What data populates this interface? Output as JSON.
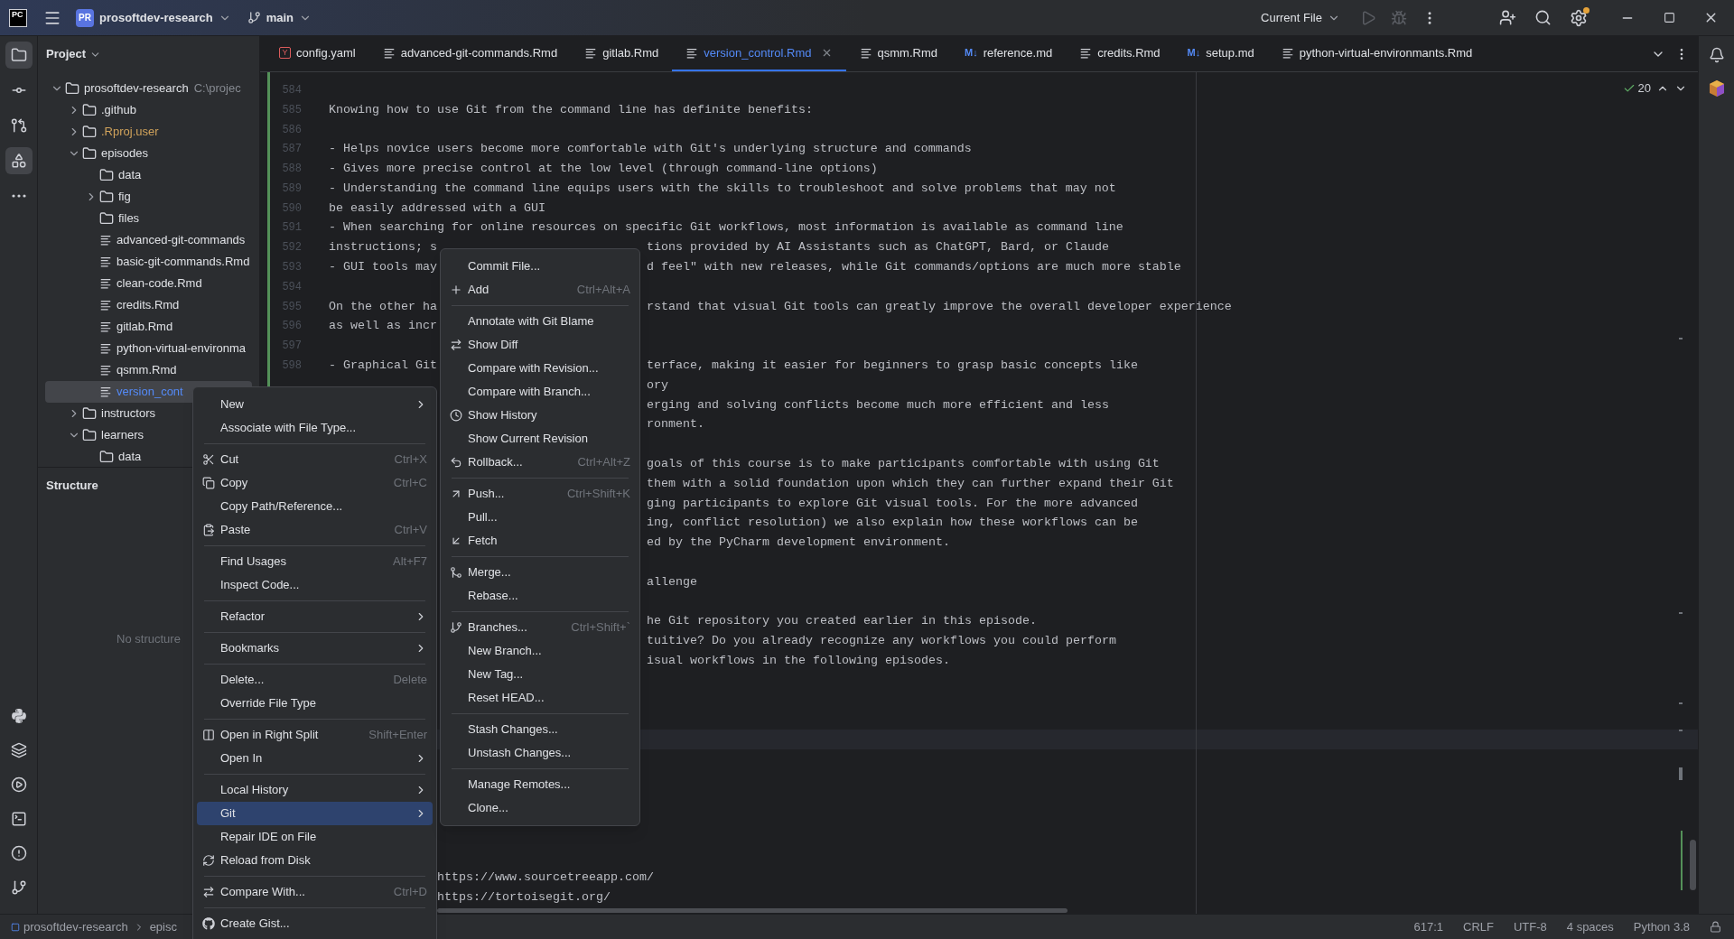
{
  "title_bar": {
    "logo": "PC",
    "project_badge": "PR",
    "project": "prosoftdev-research",
    "branch": "main",
    "run_config": "Current File"
  },
  "left_toolbar": {
    "top": [
      {
        "kind": "project",
        "selected": true
      },
      {
        "kind": "commit",
        "selected": false
      },
      {
        "kind": "pull_requests",
        "selected": false
      },
      {
        "kind": "structure",
        "selected": true
      },
      {
        "kind": "more",
        "selected": false
      }
    ],
    "bottom": [
      {
        "kind": "python",
        "selected": false
      },
      {
        "kind": "layers",
        "selected": false
      },
      {
        "kind": "services",
        "selected": false
      },
      {
        "kind": "terminal",
        "selected": false
      },
      {
        "kind": "problems",
        "selected": false
      },
      {
        "kind": "git",
        "selected": false
      }
    ]
  },
  "project_panel": {
    "title": "Project",
    "items": [
      {
        "label": "prosoftdev-research",
        "path": "C:\\projec",
        "kind": "folder",
        "expanded": true,
        "selected": false,
        "children": [
          {
            "label": ".github",
            "kind": "folder",
            "expanded": false,
            "selected": false
          },
          {
            "label": ".Rproj.user",
            "kind": "folder",
            "expanded": false,
            "selected": false,
            "color": "#d1a35b"
          },
          {
            "label": "episodes",
            "kind": "folder",
            "expanded": true,
            "selected": false,
            "children": [
              {
                "label": "data",
                "kind": "folder",
                "selected": false
              },
              {
                "label": "fig",
                "kind": "folder",
                "expanded": false,
                "selected": false
              },
              {
                "label": "files",
                "kind": "folder",
                "selected": false
              },
              {
                "label": "advanced-git-commands",
                "kind": "file",
                "selected": false
              },
              {
                "label": "basic-git-commands.Rmd",
                "kind": "file",
                "selected": false
              },
              {
                "label": "clean-code.Rmd",
                "kind": "file",
                "selected": false
              },
              {
                "label": "credits.Rmd",
                "kind": "file",
                "selected": false
              },
              {
                "label": "gitlab.Rmd",
                "kind": "file",
                "selected": false
              },
              {
                "label": "python-virtual-environma",
                "kind": "file",
                "selected": false
              },
              {
                "label": "qsmm.Rmd",
                "kind": "file",
                "selected": false
              },
              {
                "label": "version_cont",
                "kind": "file",
                "selected": true,
                "color": "#548af7"
              }
            ]
          },
          {
            "label": "instructors",
            "kind": "folder",
            "expanded": false,
            "selected": false
          },
          {
            "label": "learners",
            "kind": "folder",
            "expanded": true,
            "selected": false,
            "children": [
              {
                "label": "data",
                "kind": "folder",
                "selected": false
              }
            ]
          }
        ]
      }
    ]
  },
  "structure_panel": {
    "title": "Structure",
    "empty_text": "No structure"
  },
  "tabs": [
    {
      "label": "config.yaml",
      "kind": "yaml",
      "badge": "Y",
      "selected": false
    },
    {
      "label": "advanced-git-commands.Rmd",
      "kind": "rmd",
      "selected": false
    },
    {
      "label": "gitlab.Rmd",
      "kind": "rmd",
      "selected": false
    },
    {
      "label": "version_control.Rmd",
      "kind": "rmd",
      "selected": true
    },
    {
      "label": "qsmm.Rmd",
      "kind": "rmd",
      "selected": false
    },
    {
      "label": "reference.md",
      "kind": "markdown",
      "badge": "M↓",
      "selected": false
    },
    {
      "label": "credits.Rmd",
      "kind": "rmd",
      "selected": false
    },
    {
      "label": "setup.md",
      "kind": "markdown",
      "badge": "M↓",
      "selected": false
    },
    {
      "label": "python-virtual-environmants.Rmd",
      "kind": "rmd",
      "selected": false
    }
  ],
  "editor": {
    "inspections": "20",
    "lines": [
      {
        "number": "584",
        "current": false
      },
      {
        "number": "585",
        "text": "Knowing how to use Git from the command line has definite benefits:",
        "current": false
      },
      {
        "number": "586",
        "current": false
      },
      {
        "number": "587",
        "text": "- Helps novice users become more comfortable with Git's underlying structure and commands",
        "current": false
      },
      {
        "number": "588",
        "text": "- Gives more precise control at the low level (through command-line options)",
        "current": false
      },
      {
        "number": "589",
        "text": "- Understanding the command line equips users with the skills to troubleshoot and solve problems that may not",
        "current": false
      },
      {
        "number": "590",
        "text": "be easily addressed with a GUI",
        "current": false
      },
      {
        "number": "591",
        "text": "- When searching for online resources on specific Git workflows, most information is available as command line",
        "current": false
      },
      {
        "number": "592",
        "text": "instructions; s",
        "tail": "tions provided by AI Assistants such as ChatGPT, Bard, or Claude",
        "kind": "split_git",
        "current": false
      },
      {
        "number": "593",
        "text": "- GUI tools may",
        "tail": "d feel\" with new releases, while Git commands/options are much more stable",
        "kind": "split_git",
        "current": false
      },
      {
        "number": "594",
        "current": false
      },
      {
        "number": "595",
        "text": "On the other ha",
        "tail": "rstand that visual Git tools can greatly improve the overall developer experience",
        "kind": "split_git",
        "current": false
      },
      {
        "number": "596",
        "text": "as well as incr",
        "current": false
      },
      {
        "number": "597",
        "current": false
      },
      {
        "number": "598",
        "text": "- Graphical Git",
        "tail": "terface, making it easier for beginners to grasp basic concepts like",
        "kind": "split_git",
        "current": false
      },
      {
        "tail": "ory",
        "kind": "split_git",
        "current": false
      },
      {
        "tail": "erging and solving conflicts become much more efficient and less",
        "kind": "split_git",
        "current": false
      },
      {
        "tail": "ronment.",
        "kind": "split_git",
        "current": false
      },
      {
        "current": false
      },
      {
        "tail": "goals of this course is to make participants comfortable with using Git",
        "kind": "split_git",
        "current": false
      },
      {
        "tail": "them with a solid foundation upon which they can further expand their Git",
        "kind": "split_git",
        "current": false
      },
      {
        "tail": "ging participants to explore Git visual tools. For the more advanced",
        "kind": "split_git",
        "current": false
      },
      {
        "tail": "ing, conflict resolution) we also explain how these workflows can be",
        "kind": "split_git",
        "current": false
      },
      {
        "tail": "ed by the PyCharm development environment.",
        "kind": "split_git",
        "current": false
      },
      {
        "current": false
      },
      {
        "tail": "allenge",
        "kind": "split_git",
        "current": false
      },
      {
        "current": false
      },
      {
        "tail": "he Git repository you created earlier in this episode.",
        "kind": "split_git",
        "current": false
      },
      {
        "tail": "tuitive? Do you already recognize any workflows you could perform",
        "kind": "split_git",
        "current": false
      },
      {
        "tail": "isual workflows in the following episodes.",
        "kind": "split_git",
        "current": false
      },
      {
        "current": false
      },
      {
        "current": false
      },
      {
        "current": false
      },
      {
        "current": true
      },
      {
        "current": false
      },
      {
        "current": false
      },
      {
        "current": false
      },
      {
        "current": false
      },
      {
        "current": false
      },
      {
        "current": false
      },
      {
        "tail": "https://www.sourcetreeapp.com/",
        "kind": "split_menu",
        "current": false
      },
      {
        "tail": "https://tortoisegit.org/",
        "kind": "split_menu",
        "current": false
      }
    ]
  },
  "context_menu": [
    {
      "kind": "item",
      "label": "New",
      "submenu": true,
      "selected": false
    },
    {
      "kind": "item",
      "label": "Associate with File Type...",
      "selected": false
    },
    {
      "kind": "separator"
    },
    {
      "kind": "item",
      "label": "Cut",
      "shortcut": "Ctrl+X",
      "selected": false
    },
    {
      "kind": "item",
      "label": "Copy",
      "shortcut": "Ctrl+C",
      "selected": false
    },
    {
      "kind": "item",
      "label": "Copy Path/Reference...",
      "selected": false
    },
    {
      "kind": "item",
      "label": "Paste",
      "shortcut": "Ctrl+V",
      "selected": false
    },
    {
      "kind": "separator"
    },
    {
      "kind": "item",
      "label": "Find Usages",
      "shortcut": "Alt+F7",
      "selected": false
    },
    {
      "kind": "item",
      "label": "Inspect Code...",
      "selected": false
    },
    {
      "kind": "separator"
    },
    {
      "kind": "item",
      "label": "Refactor",
      "submenu": true,
      "selected": false
    },
    {
      "kind": "separator"
    },
    {
      "kind": "item",
      "label": "Bookmarks",
      "submenu": true,
      "selected": false
    },
    {
      "kind": "separator"
    },
    {
      "kind": "item",
      "label": "Delete...",
      "shortcut": "Delete",
      "selected": false
    },
    {
      "kind": "item",
      "label": "Override File Type",
      "selected": false
    },
    {
      "kind": "separator"
    },
    {
      "kind": "item",
      "label": "Open in Right Split",
      "shortcut": "Shift+Enter",
      "selected": false
    },
    {
      "kind": "item",
      "label": "Open In",
      "submenu": true,
      "selected": false
    },
    {
      "kind": "separator"
    },
    {
      "kind": "item",
      "label": "Local History",
      "submenu": true,
      "selected": false
    },
    {
      "kind": "item",
      "label": "Git",
      "submenu": true,
      "selected": true
    },
    {
      "kind": "item",
      "label": "Repair IDE on File",
      "selected": false
    },
    {
      "kind": "item",
      "label": "Reload from Disk",
      "selected": false
    },
    {
      "kind": "separator"
    },
    {
      "kind": "item",
      "label": "Compare With...",
      "shortcut": "Ctrl+D",
      "selected": false
    },
    {
      "kind": "separator"
    },
    {
      "kind": "item",
      "label": "Create Gist...",
      "selected": false
    }
  ],
  "git_menu": [
    {
      "kind": "item",
      "label": "Commit File...",
      "selected": false
    },
    {
      "kind": "item",
      "label": "Add",
      "shortcut": "Ctrl+Alt+A",
      "selected": false
    },
    {
      "kind": "separator"
    },
    {
      "kind": "item",
      "label": "Annotate with Git Blame",
      "selected": false
    },
    {
      "kind": "item",
      "label": "Show Diff",
      "selected": false
    },
    {
      "kind": "item",
      "label": "Compare with Revision...",
      "selected": false
    },
    {
      "kind": "item",
      "label": "Compare with Branch...",
      "selected": false
    },
    {
      "kind": "item",
      "label": "Show History",
      "selected": false
    },
    {
      "kind": "item",
      "label": "Show Current Revision",
      "selected": false
    },
    {
      "kind": "item",
      "label": "Rollback...",
      "shortcut": "Ctrl+Alt+Z",
      "selected": false
    },
    {
      "kind": "separator"
    },
    {
      "kind": "item",
      "label": "Push...",
      "shortcut": "Ctrl+Shift+K",
      "selected": false
    },
    {
      "kind": "item",
      "label": "Pull...",
      "selected": false
    },
    {
      "kind": "item",
      "label": "Fetch",
      "selected": false
    },
    {
      "kind": "separator"
    },
    {
      "kind": "item",
      "label": "Merge...",
      "selected": false
    },
    {
      "kind": "item",
      "label": "Rebase...",
      "selected": false
    },
    {
      "kind": "separator"
    },
    {
      "kind": "item",
      "label": "Branches...",
      "shortcut": "Ctrl+Shift+`",
      "selected": false
    },
    {
      "kind": "item",
      "label": "New Branch...",
      "selected": false
    },
    {
      "kind": "item",
      "label": "New Tag...",
      "selected": false
    },
    {
      "kind": "item",
      "label": "Reset HEAD...",
      "selected": false
    },
    {
      "kind": "separator"
    },
    {
      "kind": "item",
      "label": "Stash Changes...",
      "selected": false
    },
    {
      "kind": "item",
      "label": "Unstash Changes...",
      "selected": false
    },
    {
      "kind": "separator"
    },
    {
      "kind": "item",
      "label": "Manage Remotes...",
      "selected": false
    },
    {
      "kind": "item",
      "label": "Clone...",
      "selected": false
    }
  ],
  "status_bar": {
    "breadcrumbs": [
      "prosoftdev-research",
      "episc"
    ],
    "position": "617:1",
    "line_separator": "CRLF",
    "encoding": "UTF-8",
    "indent": "4 spaces",
    "interpreter": "Python 3.8"
  }
}
